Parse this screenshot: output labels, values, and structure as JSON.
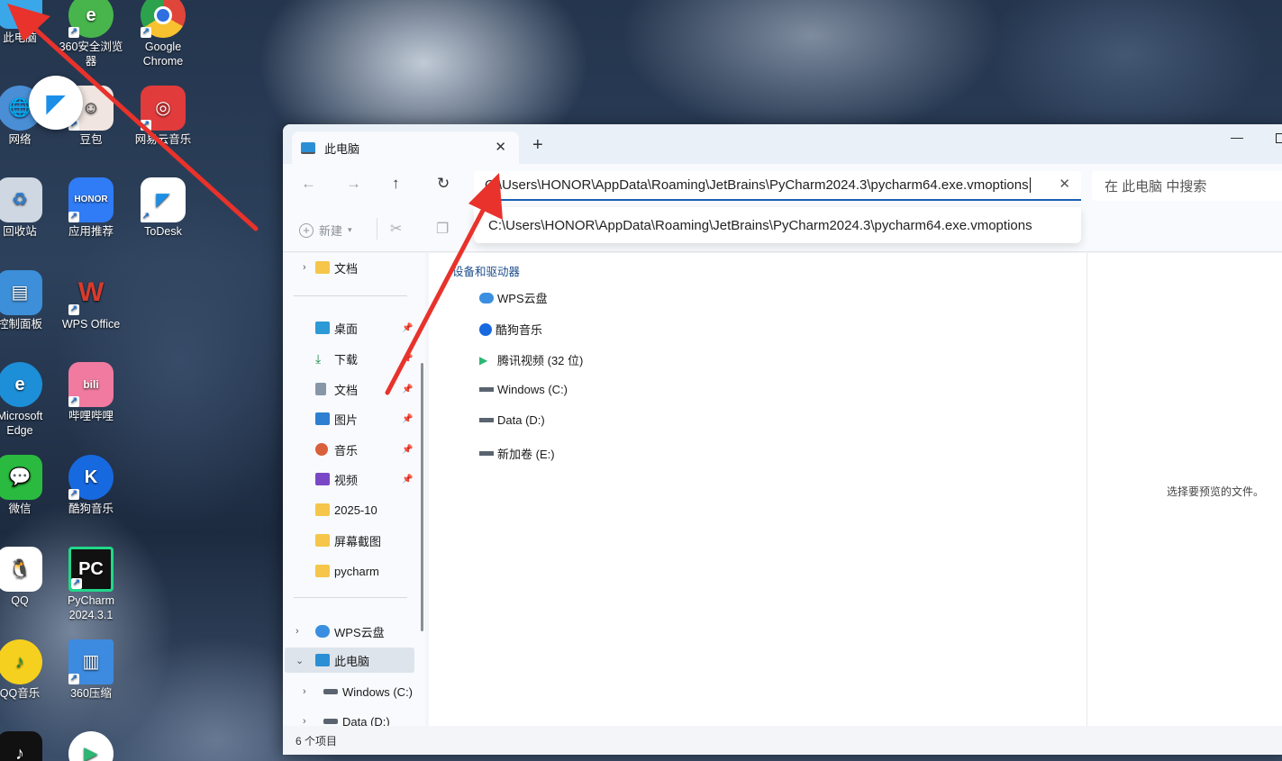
{
  "desktop": {
    "icons": [
      {
        "label": "此电脑",
        "icon": "computer-icon",
        "color": "#3aa7e8"
      },
      {
        "label": "360安全浏览器",
        "icon": "browser-360-icon",
        "color": "#47b54c"
      },
      {
        "label": "Google Chrome",
        "icon": "chrome-icon",
        "color": "#e0453a"
      },
      {
        "label": "网络",
        "icon": "network-icon",
        "color": "#4a8fd6"
      },
      {
        "label": "豆包",
        "icon": "doubao-icon",
        "color": "#f0e5e0"
      },
      {
        "label": "网易云音乐",
        "icon": "netease-music-icon",
        "color": "#e13b3b"
      },
      {
        "label": "回收站",
        "icon": "recycle-bin-icon",
        "color": "#cfd8e2"
      },
      {
        "label": "应用推荐",
        "icon": "honor-app-icon",
        "color": "#2f7cf6"
      },
      {
        "label": "ToDesk",
        "icon": "todesk-icon",
        "color": "#ffffff"
      },
      {
        "label": "控制面板",
        "icon": "control-panel-icon",
        "color": "#3c8fd8"
      },
      {
        "label": "WPS Office",
        "icon": "wps-icon",
        "color": "#d93b2c"
      },
      {
        "label": "Microsoft Edge",
        "icon": "edge-icon",
        "color": "#1d8ed8"
      },
      {
        "label": "哔哩哔哩",
        "icon": "bilibili-icon",
        "color": "#f07aa0"
      },
      {
        "label": "微信",
        "icon": "wechat-icon",
        "color": "#2aba3f"
      },
      {
        "label": "酷狗音乐",
        "icon": "kugou-icon",
        "color": "#1769e0"
      },
      {
        "label": "QQ",
        "icon": "qq-icon",
        "color": "#ffffff"
      },
      {
        "label": "PyCharm 2024.3.1",
        "icon": "pycharm-icon",
        "color": "#111111"
      },
      {
        "label": "QQ音乐",
        "icon": "qq-music-icon",
        "color": "#f5d01e"
      },
      {
        "label": "360压缩",
        "icon": "zip-360-icon",
        "color": "#3d8be0"
      }
    ]
  },
  "explorer": {
    "tab_title": "此电脑",
    "new_tab": "+",
    "address_value": "C:\\Users\\HONOR\\AppData\\Roaming\\JetBrains\\PyCharm2024.3\\pycharm64.exe.vmoptions",
    "suggestion": "C:\\Users\\HONOR\\AppData\\Roaming\\JetBrains\\PyCharm2024.3\\pycharm64.exe.vmoptions",
    "search_placeholder": "在 此电脑 中搜索",
    "toolbar_new": "新建",
    "sidebar": {
      "docs_top": "文档",
      "quick_access": [
        {
          "label": "桌面",
          "icon": "desktop-folder-icon",
          "pinned": true
        },
        {
          "label": "下载",
          "icon": "download-icon",
          "pinned": true
        },
        {
          "label": "文档",
          "icon": "documents-icon",
          "pinned": true
        },
        {
          "label": "图片",
          "icon": "pictures-icon",
          "pinned": true
        },
        {
          "label": "音乐",
          "icon": "music-icon",
          "pinned": true
        },
        {
          "label": "视频",
          "icon": "videos-icon",
          "pinned": true
        },
        {
          "label": "2025-10",
          "icon": "folder-icon",
          "pinned": false
        },
        {
          "label": "屏幕截图",
          "icon": "folder-icon",
          "pinned": false
        },
        {
          "label": "pycharm",
          "icon": "folder-icon",
          "pinned": false
        }
      ],
      "wps_cloud": "WPS云盘",
      "this_pc": "此电脑",
      "drive_c": "Windows (C:)",
      "drive_d": "Data (D:)"
    },
    "content": {
      "section_title": "设备和驱动器",
      "items": [
        {
          "label": "WPS云盘",
          "icon": "wps-cloud-icon"
        },
        {
          "label": "酷狗音乐",
          "icon": "kugou-drive-icon"
        },
        {
          "label": "腾讯视频 (32 位)",
          "icon": "tencent-video-icon"
        },
        {
          "label": "Windows (C:)",
          "icon": "windows-drive-icon"
        },
        {
          "label": "Data (D:)",
          "icon": "drive-icon"
        },
        {
          "label": "新加卷 (E:)",
          "icon": "drive-icon"
        }
      ]
    },
    "preview_text": "选择要预览的文件。",
    "status": "6 个项目"
  },
  "colors": {
    "accent": "#1a5fb4",
    "annotation_arrow": "#e8322b"
  }
}
